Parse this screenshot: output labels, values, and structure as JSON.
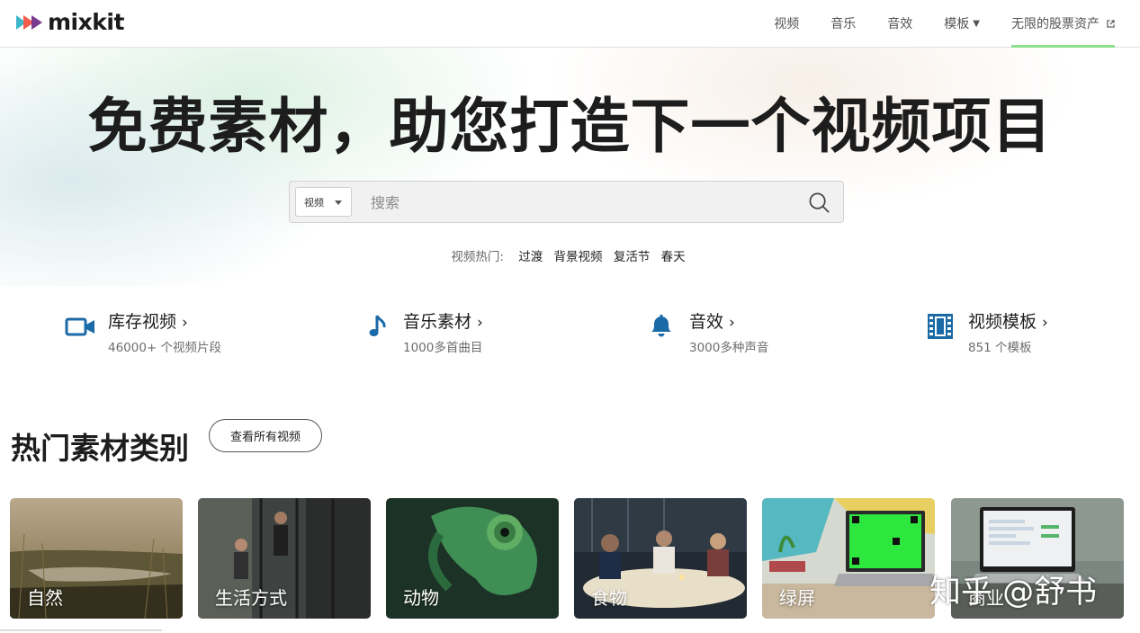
{
  "header": {
    "logo_text": "mixkit",
    "nav": [
      {
        "label": "视频"
      },
      {
        "label": "音乐"
      },
      {
        "label": "音效"
      },
      {
        "label": "模板"
      },
      {
        "label": "无限的股票资产"
      }
    ],
    "accent_color": "#8ee08e"
  },
  "hero": {
    "title": "免费素材，助您打造下一个视频项目",
    "search": {
      "type_selected": "视频",
      "placeholder": "搜索"
    },
    "trending": {
      "label": "视频热门:",
      "links": [
        "过渡",
        "背景视频",
        "复活节",
        "春天"
      ]
    }
  },
  "categories": [
    {
      "title": "库存视频",
      "subtitle": "46000+ 个视频片段",
      "icon": "video-camera-icon"
    },
    {
      "title": "音乐素材",
      "subtitle": "1000多首曲目",
      "icon": "music-note-icon"
    },
    {
      "title": "音效",
      "subtitle": "3000多种声音",
      "icon": "bell-icon"
    },
    {
      "title": "视频模板",
      "subtitle": "851 个模板",
      "icon": "film-strip-icon"
    }
  ],
  "popular": {
    "title": "热门素材类别",
    "view_all": "查看所有视频",
    "tiles": [
      {
        "label": "自然"
      },
      {
        "label": "生活方式"
      },
      {
        "label": "动物"
      },
      {
        "label": "食物"
      },
      {
        "label": "绿屏"
      },
      {
        "label": "商业"
      }
    ]
  },
  "watermark": "知乎 @舒书",
  "icon_color": "#1b6aa8"
}
